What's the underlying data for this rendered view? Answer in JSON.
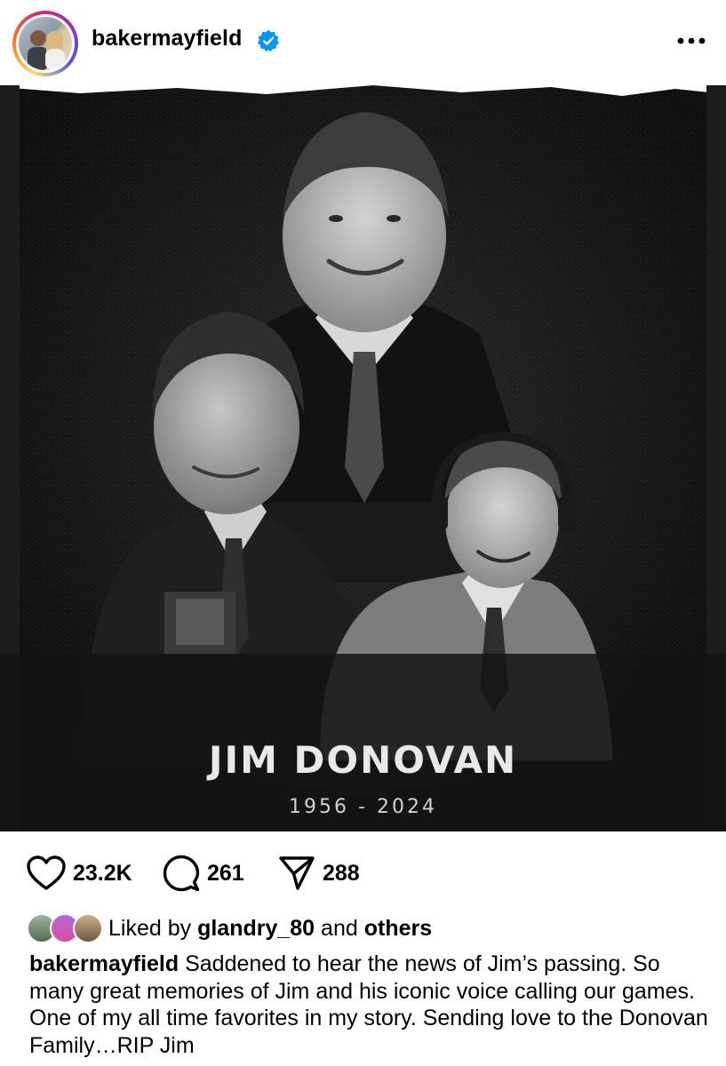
{
  "post": {
    "username": "bakermayfield",
    "verified_icon": "verified-badge-icon",
    "more_icon": "more-options-icon",
    "image": {
      "name": "JIM DONOVAN",
      "years": "1956 - 2024"
    },
    "actions": {
      "likes": "23.2K",
      "comments": "261",
      "shares": "288"
    },
    "liked_by": {
      "prefix": "Liked by",
      "user": "glandry_80",
      "connector": "and",
      "others": "others"
    },
    "caption": {
      "author": "bakermayfield",
      "text": "Saddened to hear the news of Jim’s passing. So many great memories of Jim and his iconic voice calling our games. One of my all time favorites in my story. Sending love to the Donovan Family…RIP Jim"
    }
  },
  "colors": {
    "verified": "#0095f6",
    "text": "#000000",
    "image_bg": "#161616"
  }
}
